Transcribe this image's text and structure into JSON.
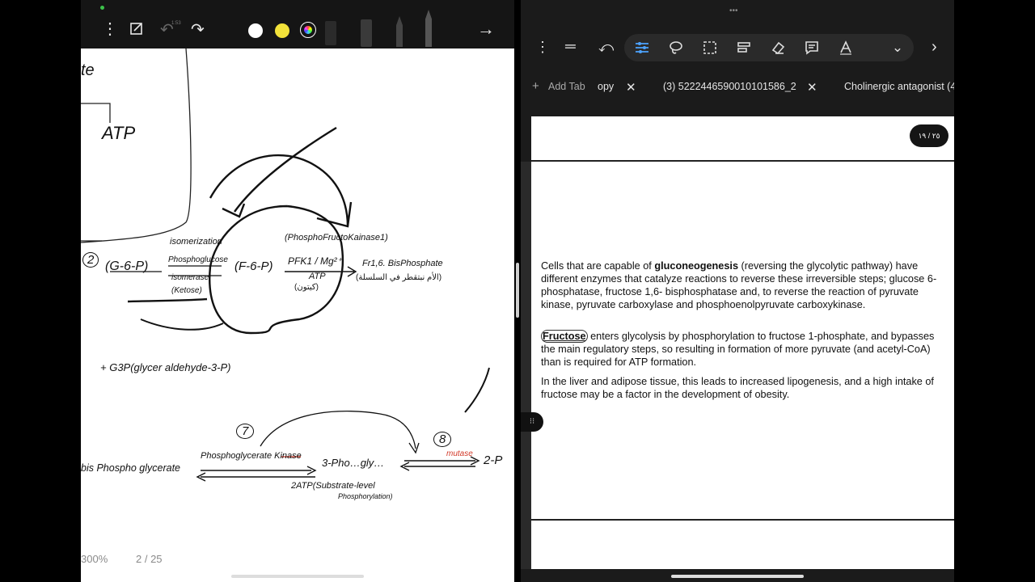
{
  "left_app": {
    "toolbar": {
      "icons": [
        "more-vert-icon",
        "crop-icon",
        "undo-icon",
        "redo-icon",
        "white-pen-icon",
        "yellow-pen-icon",
        "color-picker-icon",
        "pen-tool-icon",
        "next-arrow-icon"
      ],
      "undo_badge": "1:53",
      "swatch_colors": {
        "white": "#ffffff",
        "yellow": "#f2e23a"
      }
    },
    "canvas": {
      "notes": {
        "partial_top": "te",
        "atp_top": "ATP",
        "step2": "2",
        "g6p": "(G-6-P)",
        "isomerization": "isomerization",
        "phosphoglucose": "Phosphoglucose",
        "isomerase": "isomerase",
        "ketose": "(Ketose)",
        "f6p": "(F-6-P)",
        "pfk_name": "(PhosphoFructoKainase1)",
        "pfk1_mg": "PFK1 / Mg²⁺",
        "atp_mid": "ATP",
        "arabic1": "(كيتون)",
        "fr16": "Fr1,6. BisPhosphate",
        "arabic2": "(الأم نبتقطر في السلسلة)",
        "g3p": "+ G3P(glycer aldehyde-3-P)",
        "step7": "7",
        "step8": "8",
        "bisphospho": "bis Phospho glycerate",
        "pgk": "Phosphoglycerate Kinase",
        "three_pg": "3-Pho…gly…",
        "mutase": "mutase",
        "two_p": "2-P",
        "atp_sub": "2ATP(Substrate-level",
        "phosphorylation": "Phosphorylation)"
      }
    },
    "status": {
      "zoom": "300%",
      "page": "2 / 25"
    }
  },
  "right_app": {
    "toolbar": {
      "icons": [
        "more-vert-icon",
        "menu-icon",
        "undo-icon",
        "adjust-icon",
        "lasso-icon",
        "select-icon",
        "text-format-icon",
        "eraser-icon",
        "comment-icon",
        "text-icon",
        "chevron-down-icon",
        "chevron-right-icon"
      ],
      "active_tool": "adjust-icon"
    },
    "tabs": {
      "add_label": "Add Tab",
      "items": [
        "opy",
        "(3) 5222446590010101586_2",
        "Cholinergic antagonist (4"
      ]
    },
    "page_badge": "٢٥ / ١٩",
    "document": {
      "p1": {
        "t1": "Cells that are capable of ",
        "b1": "gluconeogenesis",
        "t2": " (reversing the glycolytic pathway) have different enzymes that catalyze reactions to reverse these irreversible steps; glucose 6-phosphatase, fructose 1,6- bisphosphatase and, to reverse the reaction of pyruvate kinase, pyruvate carboxylase and phosphoenolpyruvate carboxykinase."
      },
      "p2": {
        "b1": "Fructose",
        "t1": " enters glycolysis by phosphorylation to fructose 1-phosphate, and bypasses the main regulatory steps, so resulting in formation of more pyruvate (and acetyl-CoA) than is required for ATP formation."
      },
      "p3": "In the liver and adipose tissue, this leads to increased lipogenesis, and a high intake of fructose may be a factor in the development of obesity."
    }
  },
  "colors": {
    "accent": "#4da3ff",
    "ink": "#111111",
    "red_ink": "#d23a2a"
  }
}
